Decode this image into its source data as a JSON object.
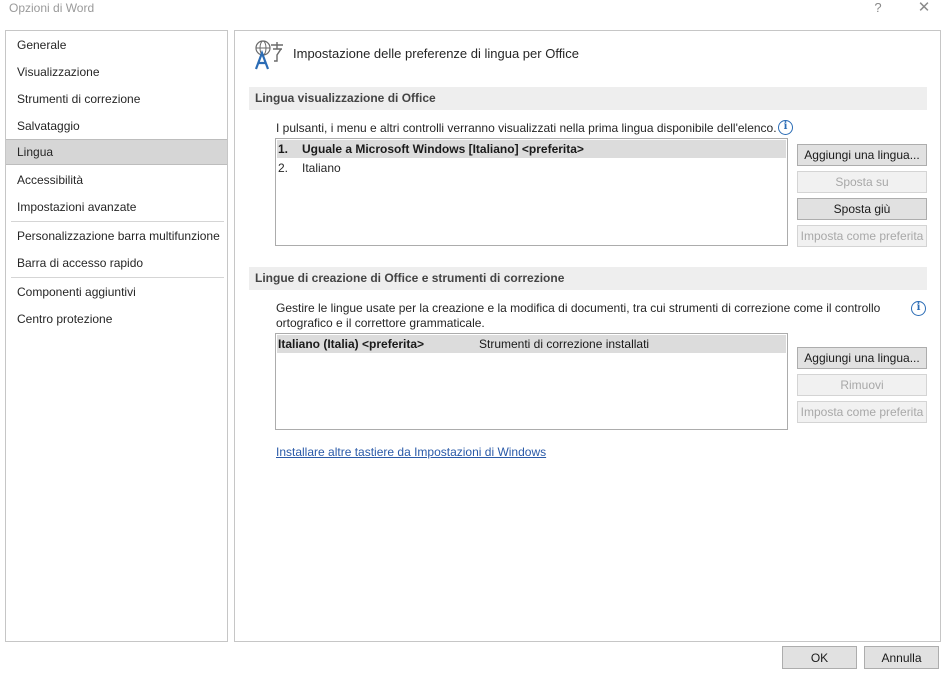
{
  "window": {
    "title": "Opzioni di Word",
    "help_glyph": "?",
    "close_glyph": "✕"
  },
  "nav": {
    "items": [
      {
        "label": "Generale"
      },
      {
        "label": "Visualizzazione"
      },
      {
        "label": "Strumenti di correzione"
      },
      {
        "label": "Salvataggio"
      },
      {
        "label": "Lingua",
        "selected": true
      },
      {
        "label": "Accessibilità"
      },
      {
        "label": "Impostazioni avanzate"
      },
      {
        "label": "Personalizzazione barra multifunzione"
      },
      {
        "label": "Barra di accesso rapido"
      },
      {
        "label": "Componenti aggiuntivi"
      },
      {
        "label": "Centro protezione"
      }
    ]
  },
  "page": {
    "icon": "language-icon",
    "title": "Impostazione delle preferenze di lingua per Office"
  },
  "display_section": {
    "header": "Lingua visualizzazione di Office",
    "description": "I pulsanti, i menu e altri controlli verranno visualizzati nella prima lingua disponibile dell'elenco.",
    "languages": [
      {
        "num": "1.",
        "name": "Uguale a Microsoft Windows [Italiano] <preferita>",
        "selected": true
      },
      {
        "num": "2.",
        "name": "Italiano",
        "selected": false
      }
    ],
    "buttons": {
      "add": "Aggiungi una lingua...",
      "move_up": "Sposta su",
      "move_down": "Sposta giù",
      "set_preferred": "Imposta come preferita"
    }
  },
  "authoring_section": {
    "header": "Lingue di creazione di Office e strumenti di correzione",
    "description_line1": "Gestire le lingue usate per la creazione e la modifica di documenti, tra cui strumenti di correzione come il controllo",
    "description_line2": "ortografico e il correttore grammaticale.",
    "languages": [
      {
        "name": "Italiano (Italia) <preferita>",
        "status": "Strumenti di correzione installati",
        "selected": true
      }
    ],
    "buttons": {
      "add": "Aggiungi una lingua...",
      "remove": "Rimuovi",
      "set_preferred": "Imposta come preferita"
    }
  },
  "link": {
    "text": "Installare altre tastiere da Impostazioni di Windows"
  },
  "footer": {
    "ok": "OK",
    "cancel": "Annulla"
  },
  "colors": {
    "accent": "#2b6cb5",
    "link": "#2a5aa8",
    "selection": "#d6d6d6"
  }
}
